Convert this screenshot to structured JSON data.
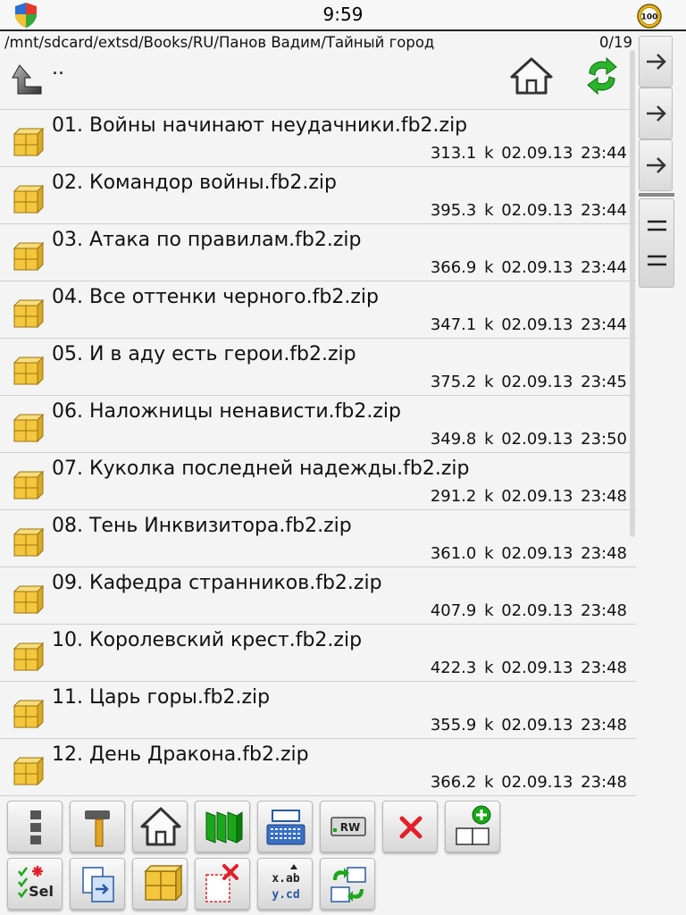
{
  "status": {
    "time": "9:59",
    "battery_level": "100"
  },
  "path": {
    "current": "/mnt/sdcard/extsd/Books/RU/Панов Вадим/Тайный город",
    "count": "0/19"
  },
  "nav": {
    "up_label": ".."
  },
  "files": [
    {
      "name": "01. Войны начинают неудачники.fb2.zip",
      "size": "313.1 k",
      "date": "02.09.13",
      "time": "23:44"
    },
    {
      "name": "02. Командор войны.fb2.zip",
      "size": "395.3 k",
      "date": "02.09.13",
      "time": "23:44"
    },
    {
      "name": "03. Атака по правилам.fb2.zip",
      "size": "366.9 k",
      "date": "02.09.13",
      "time": "23:44"
    },
    {
      "name": "04. Все оттенки черного.fb2.zip",
      "size": "347.1 k",
      "date": "02.09.13",
      "time": "23:44"
    },
    {
      "name": "05. И в аду есть герои.fb2.zip",
      "size": "375.2 k",
      "date": "02.09.13",
      "time": "23:45"
    },
    {
      "name": "06. Наложницы ненависти.fb2.zip",
      "size": "349.8 k",
      "date": "02.09.13",
      "time": "23:50"
    },
    {
      "name": "07. Куколка последней надежды.fb2.zip",
      "size": "291.2 k",
      "date": "02.09.13",
      "time": "23:48"
    },
    {
      "name": "08. Тень Инквизитора.fb2.zip",
      "size": "361.0 k",
      "date": "02.09.13",
      "time": "23:48"
    },
    {
      "name": "09. Кафедра странников.fb2.zip",
      "size": "407.9 k",
      "date": "02.09.13",
      "time": "23:48"
    },
    {
      "name": "10. Королевский крест.fb2.zip",
      "size": "422.3 k",
      "date": "02.09.13",
      "time": "23:48"
    },
    {
      "name": "11. Царь горы.fb2.zip",
      "size": "355.9 k",
      "date": "02.09.13",
      "time": "23:48"
    },
    {
      "name": "12. День Дракона.fb2.zip",
      "size": "366.2 k",
      "date": "02.09.13",
      "time": "23:48"
    }
  ],
  "toolbar": {
    "row1": [
      "menu-icon",
      "hammer-icon",
      "home-icon",
      "books-icon",
      "keyboard-icon",
      "rw-icon",
      "delete-icon",
      "new-panel-icon"
    ],
    "row2": [
      "select-icon",
      "copy-icon",
      "archive-icon",
      "delete-file-icon",
      "rename-icon",
      "swap-panels-icon"
    ],
    "rw_label": "RW",
    "sel_label": "Sel",
    "rename_top": "x.ab",
    "rename_bottom": "y.cd"
  },
  "colors": {
    "accent_green": "#1aa81a",
    "delete_red": "#e0202a",
    "folder_yellow": "#f3c63d"
  }
}
